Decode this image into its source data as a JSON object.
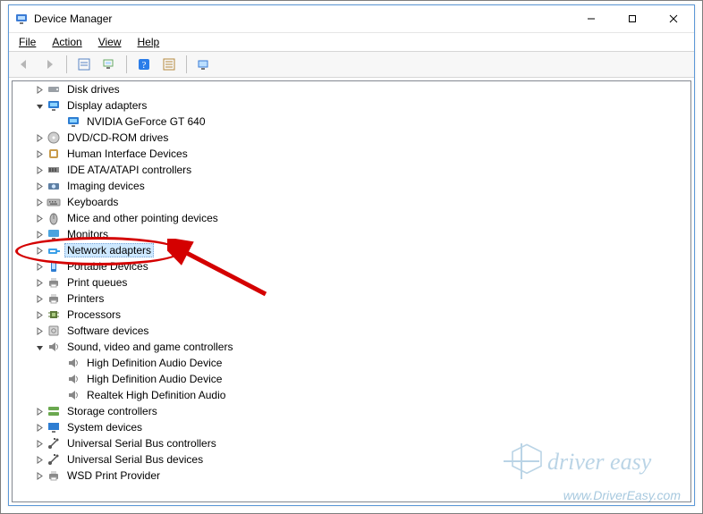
{
  "window": {
    "title": "Device Manager"
  },
  "menu": {
    "file": "File",
    "action": "Action",
    "view": "View",
    "help": "Help"
  },
  "toolbar": {
    "back": "back-icon",
    "forward": "forward-icon",
    "properties": "properties-icon",
    "scan": "scan-icon",
    "help": "help-icon",
    "legacy": "legacy-icon",
    "showhidden": "show-hidden-icon"
  },
  "tree": {
    "items": [
      {
        "label": "Disk drives",
        "level": 1,
        "expand": "collapsed",
        "icon": "disk",
        "selected": false
      },
      {
        "label": "Display adapters",
        "level": 1,
        "expand": "expanded",
        "icon": "display",
        "selected": false
      },
      {
        "label": "NVIDIA GeForce GT 640",
        "level": 2,
        "expand": "none",
        "icon": "display",
        "selected": false
      },
      {
        "label": "DVD/CD-ROM drives",
        "level": 1,
        "expand": "collapsed",
        "icon": "dvd",
        "selected": false
      },
      {
        "label": "Human Interface Devices",
        "level": 1,
        "expand": "collapsed",
        "icon": "hid",
        "selected": false
      },
      {
        "label": "IDE ATA/ATAPI controllers",
        "level": 1,
        "expand": "collapsed",
        "icon": "ide",
        "selected": false
      },
      {
        "label": "Imaging devices",
        "level": 1,
        "expand": "collapsed",
        "icon": "imaging",
        "selected": false
      },
      {
        "label": "Keyboards",
        "level": 1,
        "expand": "collapsed",
        "icon": "keyboard",
        "selected": false
      },
      {
        "label": "Mice and other pointing devices",
        "level": 1,
        "expand": "collapsed",
        "icon": "mouse",
        "selected": false
      },
      {
        "label": "Monitors",
        "level": 1,
        "expand": "collapsed",
        "icon": "monitor",
        "selected": false
      },
      {
        "label": "Network adapters",
        "level": 1,
        "expand": "collapsed",
        "icon": "network",
        "selected": true
      },
      {
        "label": "Portable Devices",
        "level": 1,
        "expand": "collapsed",
        "icon": "portable",
        "selected": false
      },
      {
        "label": "Print queues",
        "level": 1,
        "expand": "collapsed",
        "icon": "printq",
        "selected": false
      },
      {
        "label": "Printers",
        "level": 1,
        "expand": "collapsed",
        "icon": "printer",
        "selected": false
      },
      {
        "label": "Processors",
        "level": 1,
        "expand": "collapsed",
        "icon": "cpu",
        "selected": false
      },
      {
        "label": "Software devices",
        "level": 1,
        "expand": "collapsed",
        "icon": "software",
        "selected": false
      },
      {
        "label": "Sound, video and game controllers",
        "level": 1,
        "expand": "expanded",
        "icon": "sound",
        "selected": false
      },
      {
        "label": "High Definition Audio Device",
        "level": 2,
        "expand": "none",
        "icon": "sound",
        "selected": false
      },
      {
        "label": "High Definition Audio Device",
        "level": 2,
        "expand": "none",
        "icon": "sound",
        "selected": false
      },
      {
        "label": "Realtek High Definition Audio",
        "level": 2,
        "expand": "none",
        "icon": "sound",
        "selected": false
      },
      {
        "label": "Storage controllers",
        "level": 1,
        "expand": "collapsed",
        "icon": "storage",
        "selected": false
      },
      {
        "label": "System devices",
        "level": 1,
        "expand": "collapsed",
        "icon": "system",
        "selected": false
      },
      {
        "label": "Universal Serial Bus controllers",
        "level": 1,
        "expand": "collapsed",
        "icon": "usb",
        "selected": false
      },
      {
        "label": "Universal Serial Bus devices",
        "level": 1,
        "expand": "collapsed",
        "icon": "usb",
        "selected": false
      },
      {
        "label": "WSD Print Provider",
        "level": 1,
        "expand": "collapsed",
        "icon": "printq",
        "selected": false
      }
    ]
  },
  "watermark": {
    "brand": "driver easy",
    "url": "www.DriverEasy.com"
  },
  "annotation": {
    "target": "Network adapters"
  }
}
